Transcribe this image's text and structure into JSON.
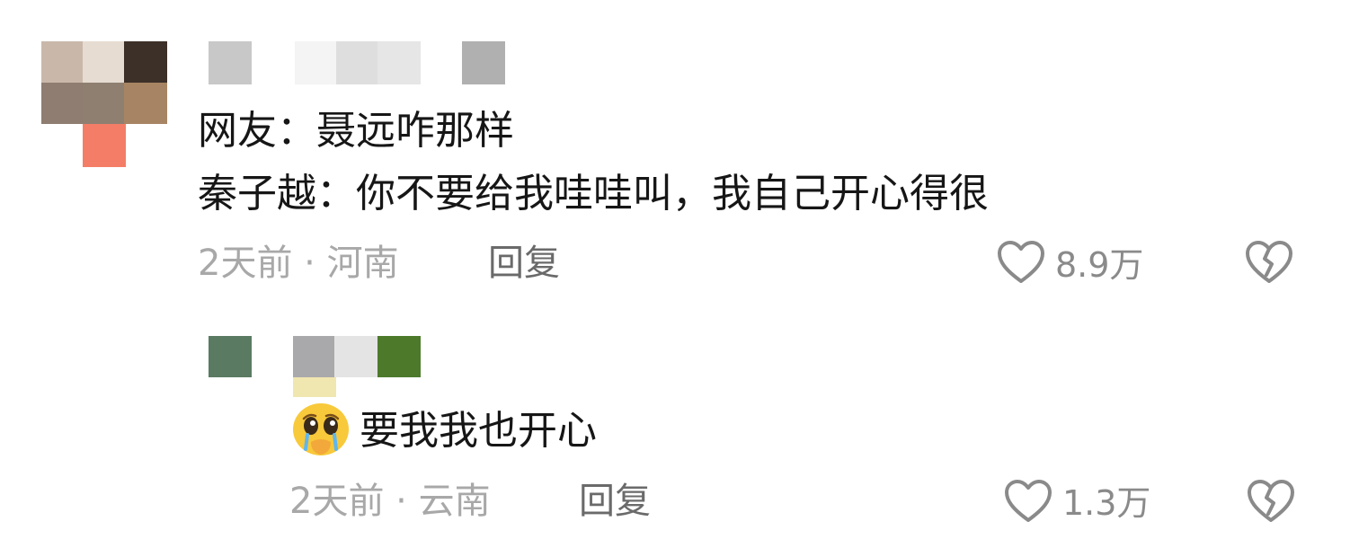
{
  "comment": {
    "text_line1": "网友：聂远咋那样",
    "text_line2": "秦子越：你不要给我哇哇叫，我自己开心得很",
    "meta": "2天前 · 河南",
    "reply_label": "回复",
    "like_count": "8.9万"
  },
  "reply": {
    "emoji": "🥹",
    "text": "要我我也开心",
    "meta": "2天前 · 云南",
    "reply_label": "回复",
    "like_count": "1.3万"
  },
  "icons": {
    "like": "heart-outline-icon",
    "dislike": "broken-heart-icon"
  },
  "colors": {
    "text": "#161616",
    "meta": "#a8a8a8",
    "reply": "#6a6a6a",
    "icon": "#888888"
  }
}
